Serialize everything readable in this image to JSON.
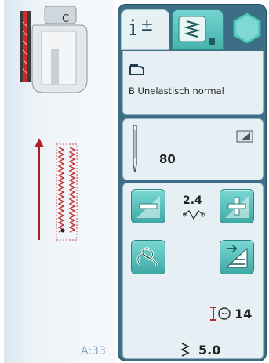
{
  "left_area": {
    "stitch_ref": "A:33"
  },
  "tabs": [
    {
      "name": "info",
      "icon": "info-plus-minus-icon"
    },
    {
      "name": "stitch",
      "icon": "stitch-menu-icon"
    },
    {
      "name": "menu",
      "icon": "hexagon-button-icon"
    }
  ],
  "stitch": {
    "foot_icon": "presser-foot-icon",
    "name": "B Unelastisch normal"
  },
  "needle": {
    "icon": "needle-icon",
    "size": "80",
    "corner_icon": "needle-corner-icon"
  },
  "params": {
    "stitch_width_value": "2.4",
    "stitch_width_icon": "stitch-width-icon",
    "decrease_icon": "minus-icon",
    "increase_icon": "plus-icon",
    "free_motion_icon": "free-motion-icon",
    "buttonhole_icon": "buttonhole-program-icon",
    "tension_value": "14",
    "tension_icon": "thread-tension-icon",
    "stitch_length_value": "5.0",
    "stitch_length_icon": "stitch-length-icon"
  },
  "colors": {
    "panel": "#3d6e86",
    "section": "#e6f0f4",
    "button_teal": "#4fb8b3",
    "stitch_red": "#c0282a"
  }
}
